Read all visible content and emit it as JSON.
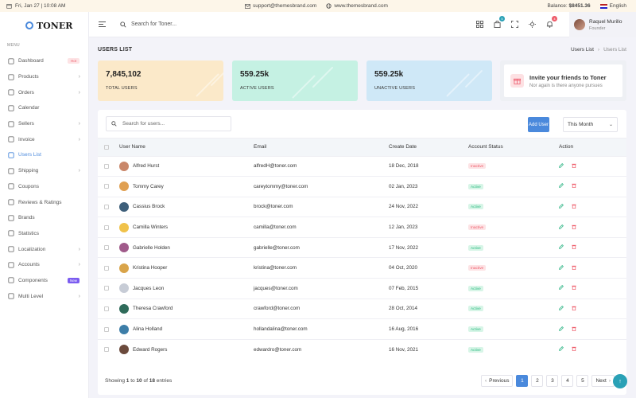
{
  "topbar": {
    "date": "Fri, Jan 27 | 10:08 AM",
    "email": "support@themesbrand.com",
    "website": "www.themesbrand.com",
    "balance_label": "Balance:",
    "balance_value": "$8451.36",
    "language": "English"
  },
  "brand": {
    "name": "TONER"
  },
  "sidebar": {
    "menu_title": "MENU",
    "items": [
      {
        "label": "Dashboard",
        "icon": "dashboard-icon",
        "badge": "Hot"
      },
      {
        "label": "Products",
        "icon": "products-icon",
        "chevron": true
      },
      {
        "label": "Orders",
        "icon": "orders-icon",
        "chevron": true
      },
      {
        "label": "Calendar",
        "icon": "calendar-icon"
      },
      {
        "label": "Sellers",
        "icon": "sellers-icon",
        "chevron": true
      },
      {
        "label": "Invoice",
        "icon": "invoice-icon",
        "chevron": true
      },
      {
        "label": "Users List",
        "icon": "users-icon",
        "active": true
      },
      {
        "label": "Shipping",
        "icon": "shipping-icon",
        "chevron": true
      },
      {
        "label": "Coupons",
        "icon": "coupons-icon"
      },
      {
        "label": "Reviews & Ratings",
        "icon": "reviews-icon"
      },
      {
        "label": "Brands",
        "icon": "brands-icon"
      },
      {
        "label": "Statistics",
        "icon": "statistics-icon"
      },
      {
        "label": "Localization",
        "icon": "localization-icon",
        "chevron": true
      },
      {
        "label": "Accounts",
        "icon": "accounts-icon",
        "chevron": true
      },
      {
        "label": "Components",
        "icon": "components-icon",
        "badge": "New"
      },
      {
        "label": "Multi Level",
        "icon": "multilevel-icon",
        "chevron": true
      }
    ]
  },
  "header": {
    "search_placeholder": "Search for Toner...",
    "cart_count": "5",
    "notif_count": "4",
    "user_name": "Raquel Murillo",
    "user_role": "Founder"
  },
  "page": {
    "title": "USERS LIST",
    "breadcrumb": [
      "Users List",
      "Users List"
    ]
  },
  "stats": [
    {
      "value": "7,845,102",
      "label": "TOTAL USERS"
    },
    {
      "value": "559.25k",
      "label": "ACTIVE USERS"
    },
    {
      "value": "559.25k",
      "label": "UNACTIVE USERS"
    }
  ],
  "invite": {
    "title": "Invite your friends to Toner",
    "subtitle": "Nor again is there anyone pursues"
  },
  "users_panel": {
    "search_placeholder": "Search for users...",
    "add_button": "Add User",
    "period": "This Month",
    "columns": [
      "User Name",
      "Email",
      "Create Date",
      "Account Status",
      "Action"
    ],
    "rows": [
      {
        "name": "Alfred Hurst",
        "email": "alfredH@toner.com",
        "date": "18 Dec, 2018",
        "status": "Inactive",
        "avatar_color": "#c9876a"
      },
      {
        "name": "Tommy Carey",
        "email": "careytommy@toner.com",
        "date": "02 Jan, 2023",
        "status": "Active",
        "avatar_color": "#e0a052"
      },
      {
        "name": "Cassius Brock",
        "email": "brock@toner.com",
        "date": "24 Nov, 2022",
        "status": "Active",
        "avatar_color": "#3e5f7a"
      },
      {
        "name": "Camilla Winters",
        "email": "camilla@toner.com",
        "date": "12 Jan, 2023",
        "status": "Inactive",
        "avatar_color": "#f0c24a"
      },
      {
        "name": "Gabrielle Holden",
        "email": "gabrielle@toner.com",
        "date": "17 Nov, 2022",
        "status": "Active",
        "avatar_color": "#a05a8a"
      },
      {
        "name": "Kristina Hooper",
        "email": "kristina@toner.com",
        "date": "04 Oct, 2020",
        "status": "Inactive",
        "avatar_color": "#d9a44a"
      },
      {
        "name": "Jacques Leon",
        "email": "jacques@toner.com",
        "date": "07 Feb, 2015",
        "status": "Active",
        "avatar_color": "#c7ccd6"
      },
      {
        "name": "Theresa Crawford",
        "email": "crawford@toner.com",
        "date": "28 Oct, 2014",
        "status": "Active",
        "avatar_color": "#2f6b5a"
      },
      {
        "name": "Alina Holland",
        "email": "hollandalina@toner.com",
        "date": "16 Aug, 2016",
        "status": "Active",
        "avatar_color": "#3d7ea8"
      },
      {
        "name": "Edward Rogers",
        "email": "edwardro@toner.com",
        "date": "16 Nov, 2021",
        "status": "Active",
        "avatar_color": "#6b4a3c"
      }
    ],
    "footer": {
      "prefix": "Showing",
      "from": "1",
      "to_word": "to",
      "to": "10",
      "of_word": "of",
      "total": "18",
      "suffix": "entries"
    },
    "pagination": {
      "prev": "Previous",
      "pages": [
        "1",
        "2",
        "3",
        "4",
        "5"
      ],
      "active": "1",
      "next": "Next"
    }
  },
  "colors": {
    "accent": "#4a89dc",
    "active": "#29b97f",
    "inactive": "#ee5c6a"
  }
}
